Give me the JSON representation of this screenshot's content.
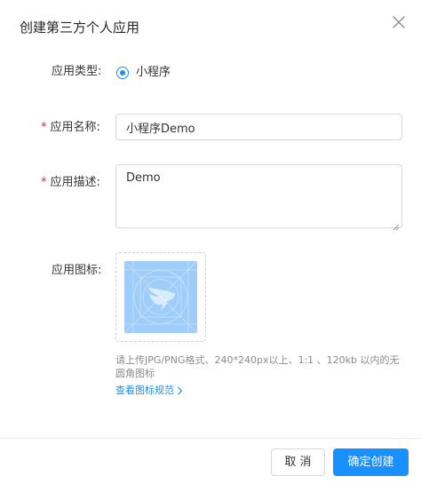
{
  "dialog": {
    "title": "创建第三方个人应用"
  },
  "form": {
    "app_type": {
      "label": "应用类型:",
      "option_label": "小程序",
      "selected": true
    },
    "app_name": {
      "required_mark": "*",
      "label": "应用名称:",
      "value": "小程序Demo"
    },
    "app_desc": {
      "required_mark": "*",
      "label": "应用描述:",
      "value": "Demo"
    },
    "app_icon": {
      "label": "应用图标:",
      "hint": "请上传JPG/PNG格式、240*240px以上、1:1 、120kb 以内的无圆角图标",
      "link": "查看图标规范"
    }
  },
  "footer": {
    "cancel_label": "取 消",
    "confirm_label": "确定创建"
  },
  "colors": {
    "primary": "#1890ff",
    "required": "#f5222d",
    "icon_placeholder_bg": "#9dcdf8"
  },
  "icons": [
    "close-icon",
    "radio-icon",
    "dingtalk-logo-icon",
    "chevron-right-icon"
  ]
}
